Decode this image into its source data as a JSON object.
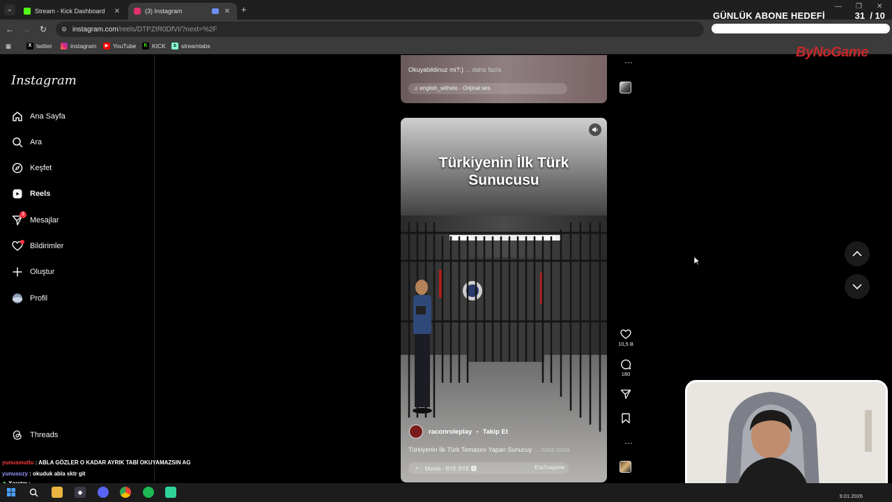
{
  "browser": {
    "tabs": [
      {
        "label": "Stream - Kick Dashboard",
        "active": false,
        "favicon_color": "#53fc18"
      },
      {
        "label": "(3) Instagram",
        "active": true,
        "favicon_color": "#e1306c"
      }
    ],
    "url_host": "instagram.com",
    "url_path": "/reels/DTPZIR0DfVI/?next=%2F",
    "bookmarks": [
      {
        "label": "twitter",
        "icon": "x-icon"
      },
      {
        "label": "instagram",
        "icon": "instagram-icon"
      },
      {
        "label": "YouTube",
        "icon": "youtube-icon"
      },
      {
        "label": "KICK",
        "icon": "kick-icon"
      },
      {
        "label": "streamlabs",
        "icon": "streamlabs-icon"
      }
    ]
  },
  "overlay": {
    "goal_title": "GÜNLÜK ABONE HEDEFİ",
    "goal_current": "31",
    "goal_target": "/ 10",
    "goal_progress": 1.0,
    "brand": "ByNoGame"
  },
  "instagram": {
    "logo": "Instagram",
    "nav": [
      {
        "label": "Ana Sayfa",
        "icon": "home-icon"
      },
      {
        "label": "Ara",
        "icon": "search-icon"
      },
      {
        "label": "Keşfet",
        "icon": "explore-icon"
      },
      {
        "label": "Reels",
        "icon": "reels-icon",
        "active": true
      },
      {
        "label": "Mesajlar",
        "icon": "messages-icon",
        "badge": "3"
      },
      {
        "label": "Bildirimler",
        "icon": "heart-icon"
      },
      {
        "label": "Oluştur",
        "icon": "create-icon"
      },
      {
        "label": "Profil",
        "icon": "profile-icon"
      }
    ],
    "threads_label": "Threads",
    "prev_reel": {
      "caption": "Okuyabildinuz mi?:)",
      "more": "... daha fazla",
      "audio": "english_withelo · Orijinal ses"
    },
    "reel": {
      "title_line1": "Türkiyenin İlk Türk",
      "title_line2": "Sunucusu",
      "username": "raconroleplay",
      "follow": "Takip Et",
      "caption": "Türkiyenin İlk Türk Temasını Yapan Sunucuy",
      "more": "... daha fazla",
      "audio": "↗ :. Murda - BYE BYE 🅴",
      "tagged": "Era7capone"
    },
    "actions": {
      "likes": "10,5 B",
      "comments": "180"
    }
  },
  "chat": [
    {
      "user": "yunusmutlu",
      "text": ": ABLA GÖZLER O KADAR AYRIK TABİ OKUYAMAZSIN AG"
    },
    {
      "user": "yunusozy",
      "text": ": okuduk abla sktr git"
    },
    {
      "user": "Xaratm",
      "text": ":"
    }
  ],
  "taskbar": {
    "date": "9.01.2026"
  },
  "colors": {
    "accent_red": "#ff3040",
    "kick_green": "#53fc18",
    "brand_red": "#c4282a"
  }
}
